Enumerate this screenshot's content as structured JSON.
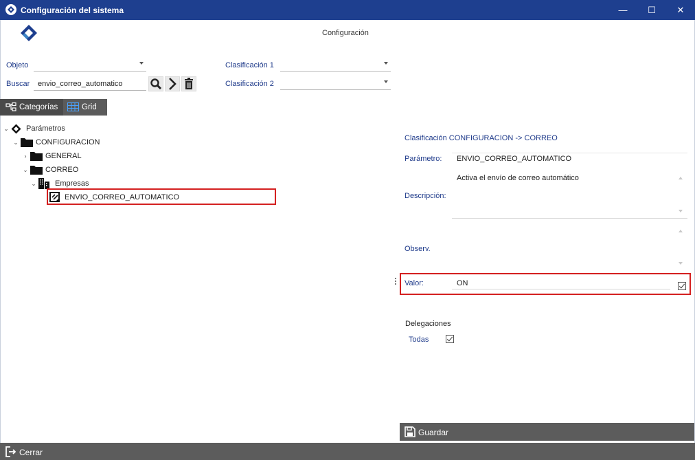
{
  "window": {
    "title": "Configuración del sistema",
    "minimize_glyph": "—",
    "maximize_glyph": "☐",
    "close_glyph": "✕"
  },
  "header": {
    "label": "Configuración"
  },
  "filters": {
    "objeto_label": "Objeto",
    "objeto_value": "",
    "buscar_label": "Buscar",
    "buscar_value": "envio_correo_automatico",
    "clasificacion1_label": "Clasificación 1",
    "clasificacion1_value": "",
    "clasificacion2_label": "Clasificación 2",
    "clasificacion2_value": ""
  },
  "tabs": [
    {
      "label": "Categorías",
      "icon": "tree-icon"
    },
    {
      "label": "Grid",
      "icon": "grid-icon",
      "active": true
    }
  ],
  "tree": {
    "root": "Parámetros",
    "configuracion": "CONFIGURACION",
    "general": "GENERAL",
    "correo": "CORREO",
    "empresas": "Empresas",
    "selected_item": "ENVIO_CORREO_AUTOMATICO"
  },
  "detail": {
    "clasificacion_text": "Clasificación CONFIGURACION -> CORREO",
    "parametro_label": "Parámetro:",
    "parametro_value": "ENVIO_CORREO_AUTOMATICO",
    "descripcion_label": "Descripción:",
    "descripcion_value": "Activa el envío de correo automático",
    "observ_label": "Observ.",
    "observ_value": "",
    "valor_label": "Valor:",
    "valor_value": "ON",
    "valor_checked": true,
    "delegaciones_label": "Delegaciones",
    "todas_label": "Todas",
    "todas_checked": true
  },
  "actions": {
    "guardar_label": "Guardar",
    "cerrar_label": "Cerrar"
  },
  "colors": {
    "titlebar": "#1e3f8f",
    "label_blue": "#1e3a8a",
    "dark_bar": "#5c5c5c",
    "highlight": "#d42020"
  }
}
